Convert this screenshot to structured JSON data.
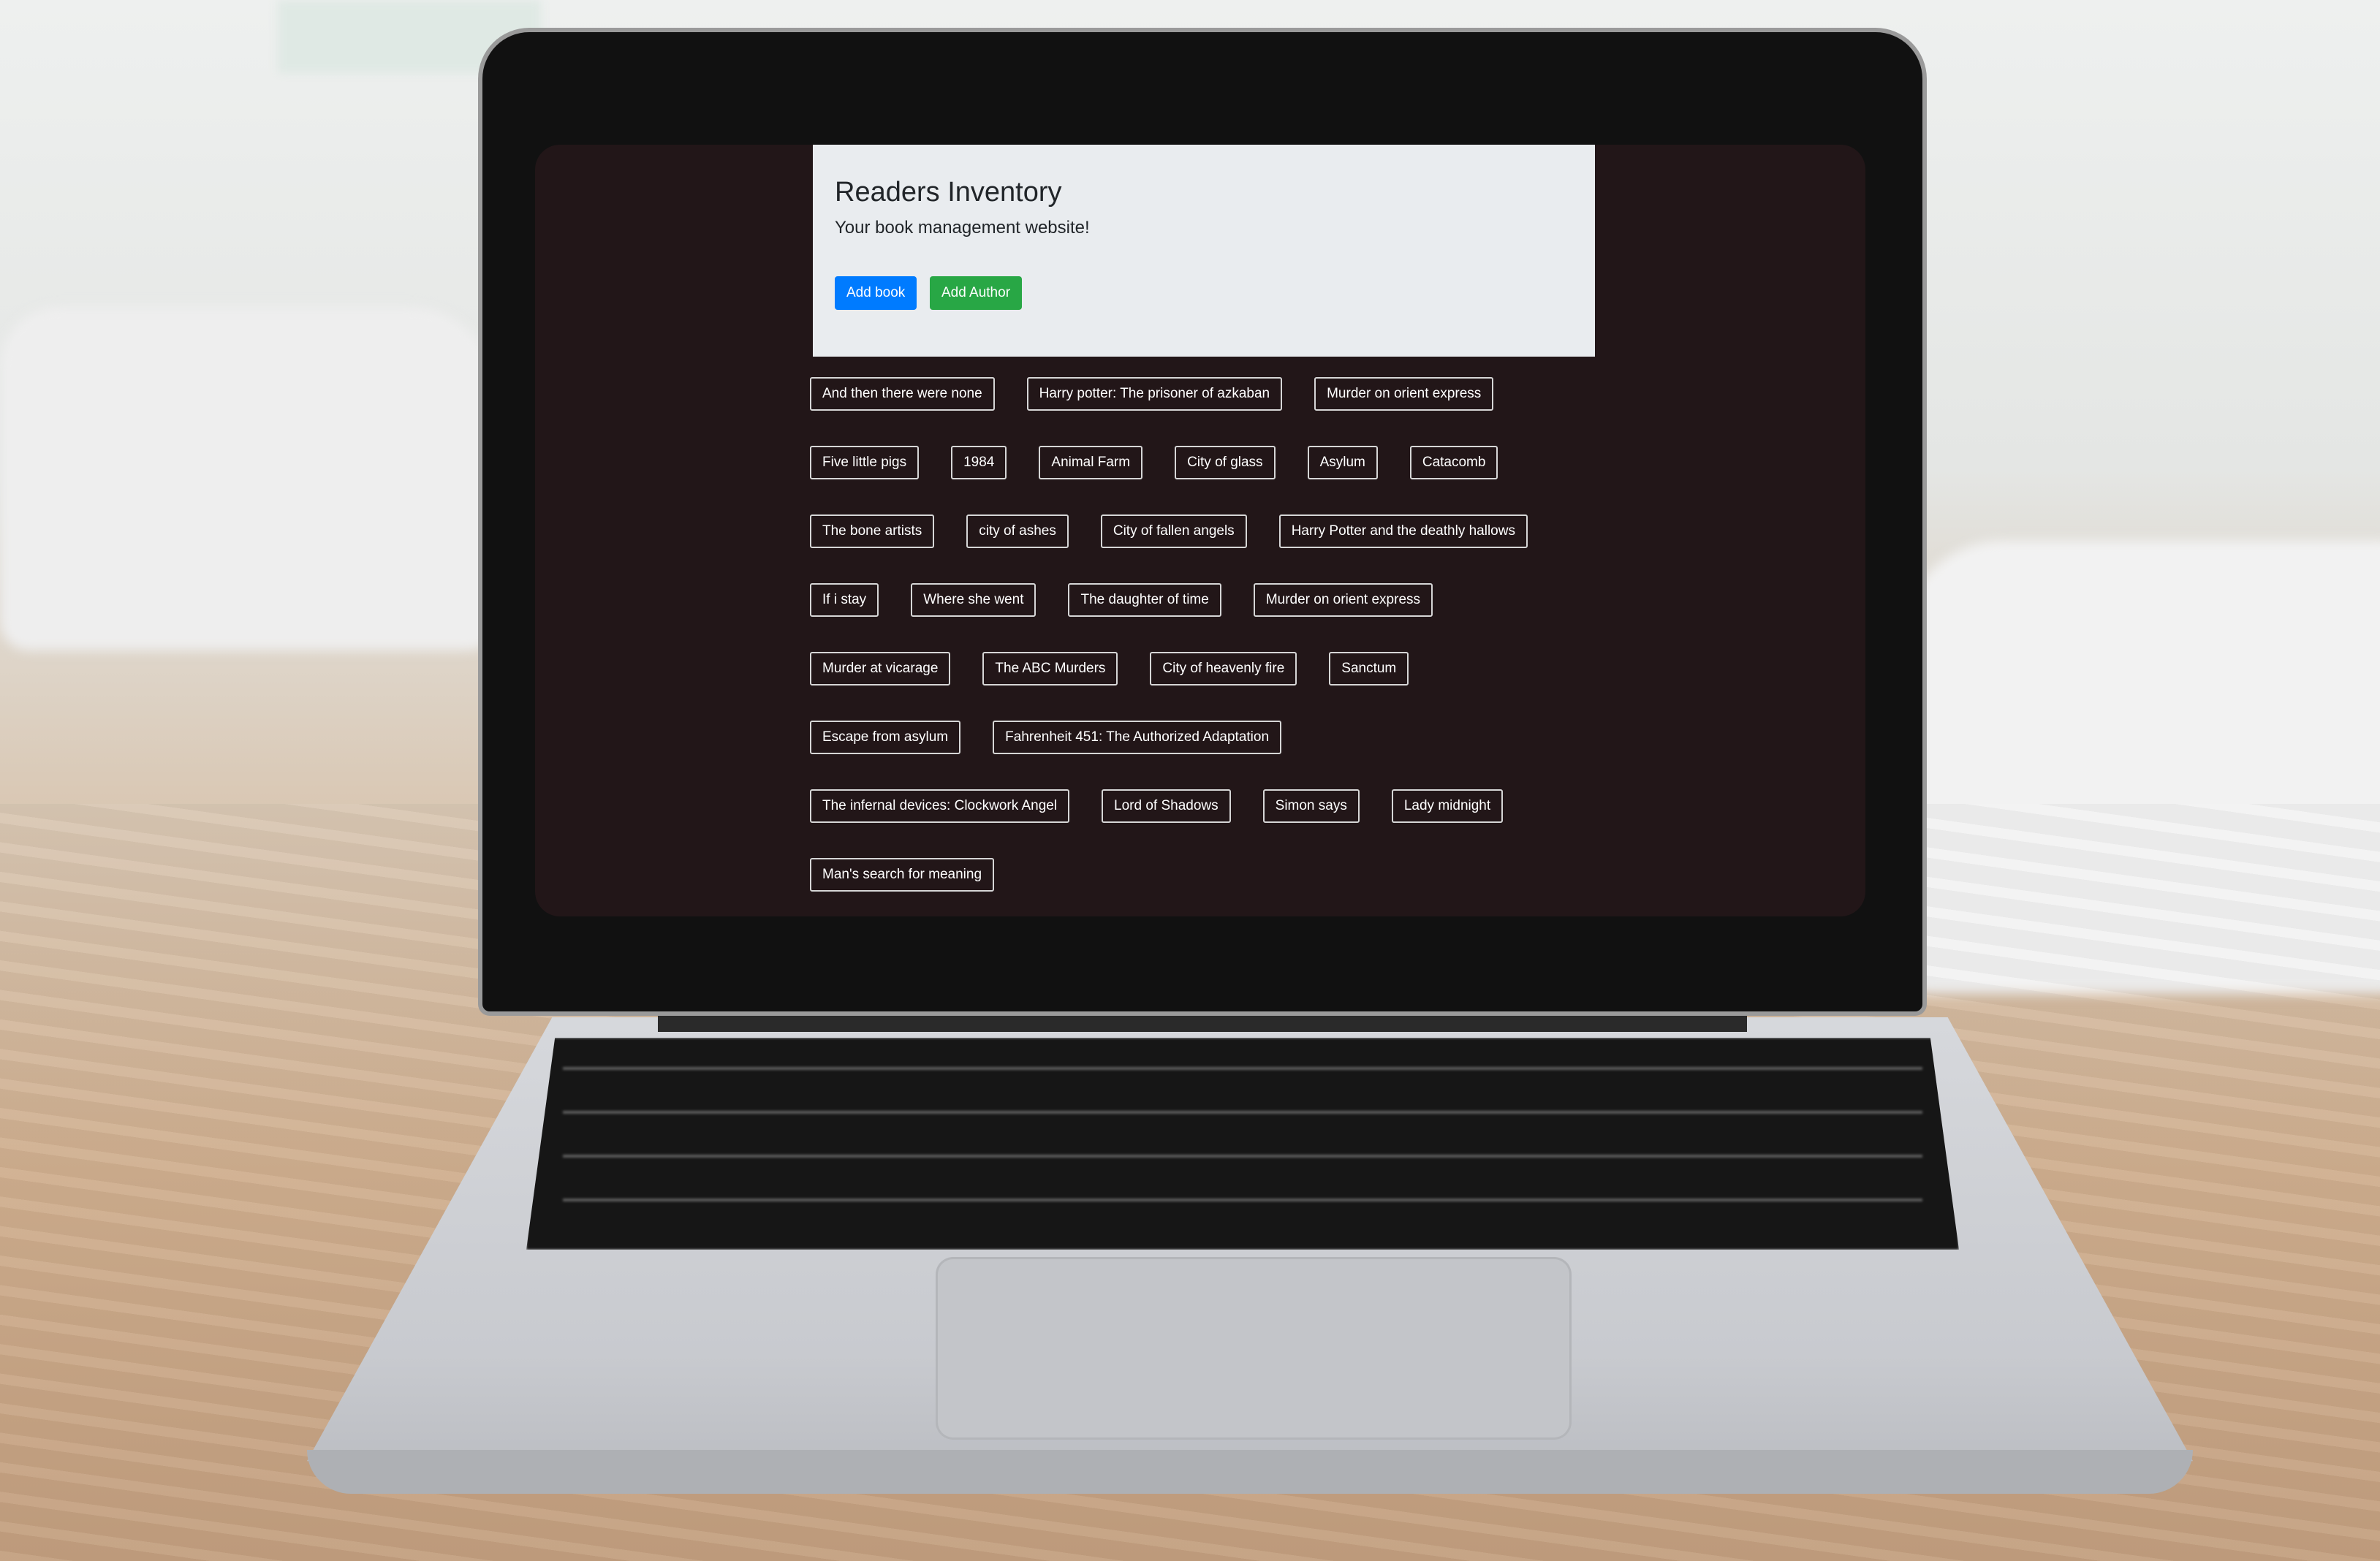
{
  "site": {
    "title": "Readers Inventory",
    "subtitle": "Your book management website!",
    "add_book_label": "Add book",
    "add_author_label": "Add Author",
    "colors": {
      "add_book": "#007bff",
      "add_author": "#28a745",
      "page_background": "#221618"
    }
  },
  "books": [
    [
      "And then there were none",
      "Harry potter: The prisoner of azkaban",
      "Murder on orient express"
    ],
    [
      "Five little pigs",
      "1984",
      "Animal Farm",
      "City of glass",
      "Asylum",
      "Catacomb"
    ],
    [
      "The bone artists",
      "city of ashes",
      "City of fallen angels",
      "Harry Potter and the deathly hallows"
    ],
    [
      "If i stay",
      "Where she went",
      "The daughter of time",
      "Murder on orient express"
    ],
    [
      "Murder at vicarage",
      "The ABC Murders",
      "City of heavenly fire",
      "Sanctum"
    ],
    [
      "Escape from asylum",
      "Fahrenheit 451: The Authorized Adaptation"
    ],
    [
      "The infernal devices: Clockwork Angel",
      "Lord of Shadows",
      "Simon says",
      "Lady midnight"
    ],
    [
      "Man's search for meaning"
    ]
  ]
}
